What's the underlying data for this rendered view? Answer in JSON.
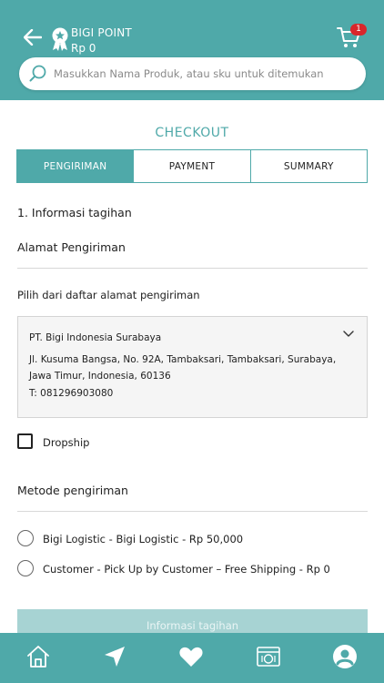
{
  "header": {
    "point_label": "BIGI POINT",
    "point_value": "Rp 0",
    "cart_count": "1"
  },
  "search": {
    "placeholder": "Masukkan Nama Produk, atau sku untuk ditemukan"
  },
  "page": {
    "title": "CHECKOUT"
  },
  "tabs": [
    {
      "label": "PENGIRIMAN",
      "active": true
    },
    {
      "label": "PAYMENT",
      "active": false
    },
    {
      "label": "SUMMARY",
      "active": false
    }
  ],
  "billing": {
    "section_title": "1. Informasi tagihan",
    "address_heading": "Alamat Pengiriman",
    "choose_label": "Pilih dari daftar alamat pengiriman",
    "address": {
      "name": "PT. Bigi Indonesia Surabaya",
      "line1": "Jl. Kusuma Bangsa, No. 92A, Tambaksari, Tambaksari, Surabaya,",
      "line2": "Jawa Timur, Indonesia, 60136",
      "phone": "T: 081296903080"
    },
    "dropship_label": "Dropship"
  },
  "shipping": {
    "title": "Metode pengiriman",
    "options": [
      {
        "label": "Bigi Logistic - Bigi Logistic - Rp 50,000",
        "selected": false
      },
      {
        "label": "Customer - Pick Up by Customer – Free Shipping - Rp 0",
        "selected": false
      }
    ]
  },
  "submit": {
    "label": "Informasi tagihan"
  },
  "bottom_nav": {
    "items": [
      "home-icon",
      "location-arrow-icon",
      "heart-icon",
      "promo-icon",
      "account-icon"
    ]
  },
  "colors": {
    "brand": "#4fa9a9",
    "badge": "#d9262b",
    "button_disabled": "#a7d3d3"
  }
}
